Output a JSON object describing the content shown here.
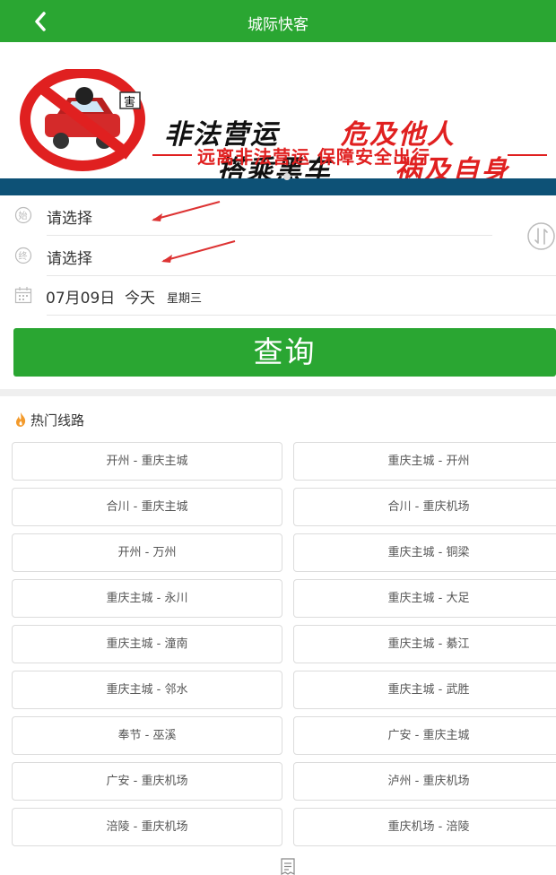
{
  "header": {
    "title": "城际快客"
  },
  "banner": {
    "line1_black": "非法营运",
    "line1_red": "危及他人",
    "line2_black": "搭乘黑车",
    "line2_red": "祸及自身",
    "footer": "远离非法营运 保障安全出行",
    "sign_text": "害"
  },
  "form": {
    "origin": {
      "icon_text": "始",
      "placeholder": "请选择"
    },
    "destination": {
      "icon_text": "终",
      "placeholder": "请选择"
    },
    "date": {
      "date": "07月09日",
      "today": "今天",
      "weekday": "星期三"
    },
    "query_label": "查询"
  },
  "hot_routes": {
    "title": "热门线路",
    "items": [
      "开州 - 重庆主城",
      "重庆主城 - 开州",
      "合川 - 重庆主城",
      "合川 - 重庆机场",
      "开州 - 万州",
      "重庆主城 - 铜梁",
      "重庆主城 - 永川",
      "重庆主城 - 大足",
      "重庆主城 - 潼南",
      "重庆主城 - 綦江",
      "重庆主城 - 邻水",
      "重庆主城 - 武胜",
      "奉节 - 巫溪",
      "广安 - 重庆主城",
      "广安 - 重庆机场",
      "泸州 - 重庆机场",
      "涪陵 - 重庆机场",
      "重庆机场 - 涪陵"
    ]
  },
  "colors": {
    "brand_green": "#2aa632",
    "banner_red": "#e02020",
    "banner_blue": "#0d5176"
  }
}
